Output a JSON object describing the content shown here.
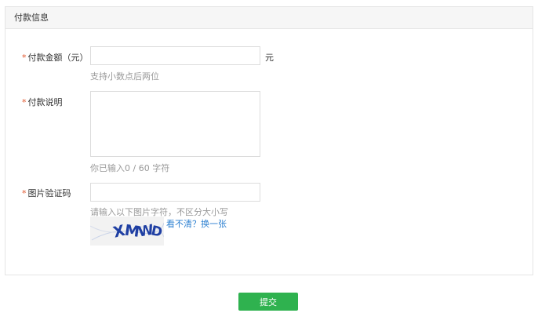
{
  "section": {
    "title": "付款信息"
  },
  "form": {
    "amount": {
      "required_mark": "*",
      "label": "付款金额（元）",
      "value": "",
      "unit": "元",
      "hint": "支持小数点后两位"
    },
    "description": {
      "required_mark": "*",
      "label": "付款说明",
      "value": "",
      "counter": "你已输入0 / 60 字符"
    },
    "captcha": {
      "required_mark": "*",
      "label": "图片验证码",
      "value": "",
      "hint": "请输入以下图片字符，不区分大小写",
      "image_text": "XMWD",
      "refresh_link": "看不清？换一张"
    }
  },
  "actions": {
    "submit_label": "提交"
  },
  "colors": {
    "accent": "#2fb24f",
    "link": "#2b7fd0",
    "required": "#e0562c",
    "captcha_text": "#1f3fa3"
  }
}
